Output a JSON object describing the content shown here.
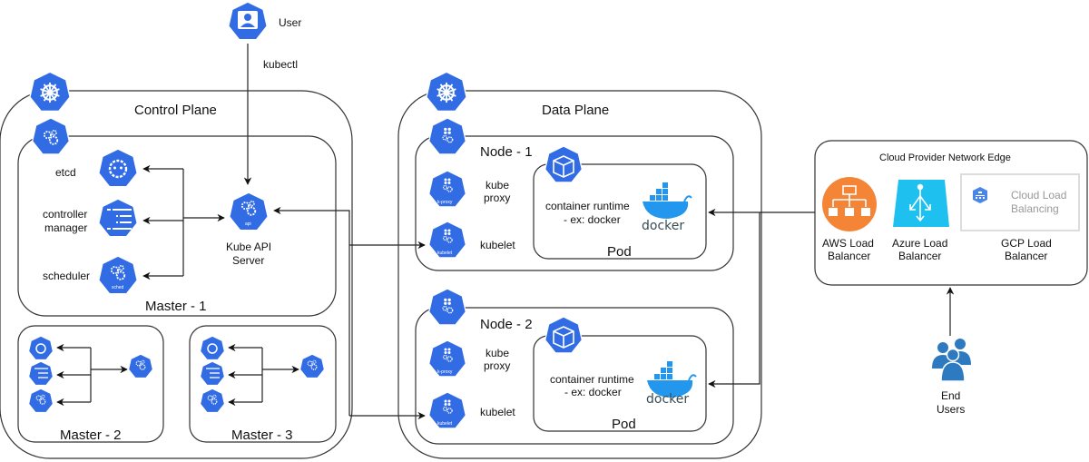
{
  "user": {
    "label": "User",
    "icon": "user-icon",
    "edge_label": "kubectl"
  },
  "control_plane": {
    "title": "Control Plane",
    "icon": "kubernetes-helm-icon",
    "master_1": {
      "title": "Master - 1",
      "icon": "control-plane-gears-icon",
      "components": [
        {
          "label": "etcd",
          "icon": "etcd-icon"
        },
        {
          "label_line1": "controller",
          "label_line2": "manager",
          "icon": "controller-manager-icon"
        },
        {
          "label": "scheduler",
          "icon": "scheduler-icon",
          "badge": "sched"
        }
      ],
      "api_server": {
        "label_line1": "Kube API",
        "label_line2": "Server",
        "badge": "api"
      }
    },
    "master_2": {
      "title": "Master - 2"
    },
    "master_3": {
      "title": "Master - 3"
    }
  },
  "data_plane": {
    "title": "Data Plane",
    "icon": "kubernetes-helm-icon",
    "nodes": [
      {
        "title": "Node - 1",
        "kube_proxy": {
          "label_line1": "kube",
          "label_line2": "proxy",
          "badge": "k-proxy"
        },
        "kubelet": {
          "label": "kubelet",
          "badge": "kubelet"
        },
        "pod": {
          "title": "Pod",
          "runtime_line1": "container runtime",
          "runtime_line2": "- ex: docker",
          "logo_text": "docker"
        }
      },
      {
        "title": "Node - 2",
        "kube_proxy": {
          "label_line1": "kube",
          "label_line2": "proxy",
          "badge": "k-proxy"
        },
        "kubelet": {
          "label": "kubelet",
          "badge": "kubelet"
        },
        "pod": {
          "title": "Pod",
          "runtime_line1": "container runtime",
          "runtime_line2": "- ex: docker",
          "logo_text": "docker"
        }
      }
    ]
  },
  "cloud_edge": {
    "title": "Cloud Provider Network Edge",
    "balancers": [
      {
        "label_line1": "AWS Load",
        "label_line2": "Balancer",
        "icon": "aws-elb-icon",
        "color": "#f58536"
      },
      {
        "label_line1": "Azure Load",
        "label_line2": "Balancer",
        "icon": "azure-lb-icon",
        "color": "#1ec0f0"
      },
      {
        "label_line1": "GCP Load",
        "label_line2": "Balancer",
        "icon": "gcp-cloud-lb-icon",
        "card_line1": "Cloud Load",
        "card_line2": "Balancing",
        "color": "#4a86e8"
      }
    ]
  },
  "end_users": {
    "label_line1": "End",
    "label_line2": "Users",
    "icon": "users-group-icon",
    "color": "#2d7ac0"
  },
  "colors": {
    "k8s_blue": "#326ce5",
    "docker_blue": "#2396ed"
  }
}
